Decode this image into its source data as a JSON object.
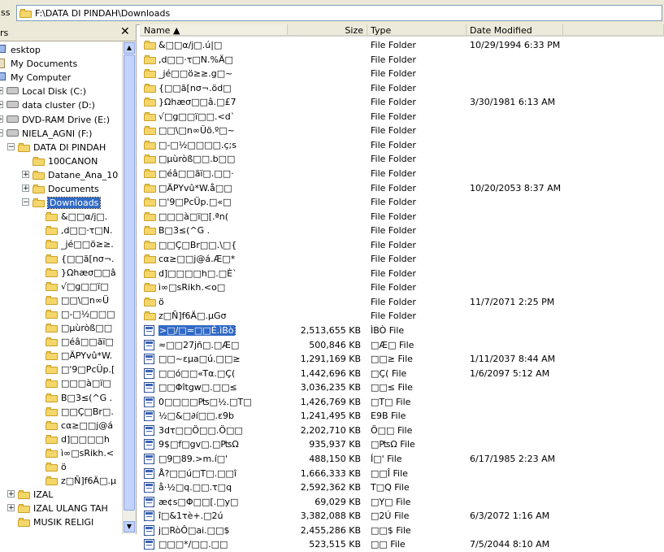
{
  "address": {
    "label": "ss",
    "path": "F:\\DATA DI PINDAH\\Downloads"
  },
  "tree": {
    "header": "rs",
    "close_glyph": "✕",
    "nodes": [
      {
        "label": "esktop",
        "icon": "desktop-icon",
        "level": 0,
        "expander": ""
      },
      {
        "label": "My Documents",
        "icon": "documents-icon",
        "level": 0,
        "expander": ""
      },
      {
        "label": "My Computer",
        "icon": "computer-icon",
        "level": 0,
        "expander": ""
      },
      {
        "label": "Local Disk (C:)",
        "icon": "drive-icon",
        "level": 1,
        "expander": "+"
      },
      {
        "label": "data cluster (D:)",
        "icon": "drive-icon",
        "level": 1,
        "expander": "+"
      },
      {
        "label": "DVD-RAM Drive (E:)",
        "icon": "drive-icon",
        "level": 1,
        "expander": "+"
      },
      {
        "label": "NIELA_AGNI (F:)",
        "icon": "drive-icon",
        "level": 1,
        "expander": "-"
      },
      {
        "label": "DATA DI PINDAH",
        "icon": "folder-icon",
        "level": 2,
        "expander": "-"
      },
      {
        "label": "100CANON",
        "icon": "folder-icon",
        "level": 3,
        "expander": ""
      },
      {
        "label": "Datane_Ana_10",
        "icon": "folder-icon",
        "level": 3,
        "expander": "+"
      },
      {
        "label": "Documents",
        "icon": "folder-icon",
        "level": 3,
        "expander": "+"
      },
      {
        "label": "Downloads",
        "icon": "folder-icon",
        "level": 3,
        "expander": "-",
        "selected": true
      },
      {
        "label": "&□□α/j□.",
        "icon": "folder-icon",
        "level": 4,
        "expander": ""
      },
      {
        "label": ",d□□·τ□N.",
        "icon": "folder-icon",
        "level": 4,
        "expander": ""
      },
      {
        "label": "_jé□□ö≥≥.",
        "icon": "folder-icon",
        "level": 4,
        "expander": ""
      },
      {
        "label": "{□□ã[nσ¬.",
        "icon": "folder-icon",
        "level": 4,
        "expander": ""
      },
      {
        "label": "}Ωhæσ□□â",
        "icon": "folder-icon",
        "level": 4,
        "expander": ""
      },
      {
        "label": "√□g□□ï□",
        "icon": "folder-icon",
        "level": 4,
        "expander": ""
      },
      {
        "label": "□□\\□n∞Ü",
        "icon": "folder-icon",
        "level": 4,
        "expander": ""
      },
      {
        "label": "□-□½□□□",
        "icon": "folder-icon",
        "level": 4,
        "expander": ""
      },
      {
        "label": "□µùròß□□",
        "icon": "folder-icon",
        "level": 4,
        "expander": ""
      },
      {
        "label": "□éâ□□ãï□",
        "icon": "folder-icon",
        "level": 4,
        "expander": ""
      },
      {
        "label": "□ÄPYvû*W.",
        "icon": "folder-icon",
        "level": 4,
        "expander": ""
      },
      {
        "label": "□'9□PcÜp.[",
        "icon": "folder-icon",
        "level": 4,
        "expander": ""
      },
      {
        "label": "□□□à□ï□",
        "icon": "folder-icon",
        "level": 4,
        "expander": ""
      },
      {
        "label": "B□3≤(^G .",
        "icon": "folder-icon",
        "level": 4,
        "expander": ""
      },
      {
        "label": "□□Ç□Br□.",
        "icon": "folder-icon",
        "level": 4,
        "expander": ""
      },
      {
        "label": "cα≥□□j@á",
        "icon": "folder-icon",
        "level": 4,
        "expander": ""
      },
      {
        "label": "d]□□□□h",
        "icon": "folder-icon",
        "level": 4,
        "expander": ""
      },
      {
        "label": "ì∞□sRikh.<",
        "icon": "folder-icon",
        "level": 4,
        "expander": ""
      },
      {
        "label": "ö",
        "icon": "folder-icon",
        "level": 4,
        "expander": ""
      },
      {
        "label": "z□Ñ]f6Ä□.µ",
        "icon": "folder-icon",
        "level": 4,
        "expander": ""
      },
      {
        "label": "IZAL",
        "icon": "folder-icon",
        "level": 2,
        "expander": "+"
      },
      {
        "label": "IZAL ULANG TAH",
        "icon": "folder-icon",
        "level": 2,
        "expander": "+"
      },
      {
        "label": "MUSIK RELIGI",
        "icon": "folder-icon",
        "level": 2,
        "expander": ""
      }
    ]
  },
  "columns": {
    "name": "Name ▲",
    "size": "Size",
    "type": "Type",
    "date": "Date Modified"
  },
  "files": [
    {
      "name": "&□□α/j□.ú|□",
      "size": "",
      "type": "File Folder",
      "date": "10/29/1994 6:33 PM",
      "kind": "folder"
    },
    {
      "name": ",d□□·τ□N.%Ä□",
      "size": "",
      "type": "File Folder",
      "date": "",
      "kind": "folder"
    },
    {
      "name": "_jé□□ö≥≥.g□~",
      "size": "",
      "type": "File Folder",
      "date": "",
      "kind": "folder"
    },
    {
      "name": "{□□ã[nσ¬.öd□",
      "size": "",
      "type": "File Folder",
      "date": "",
      "kind": "folder"
    },
    {
      "name": "}Ωhæσ□□â.□£7",
      "size": "",
      "type": "File Folder",
      "date": "3/30/1981 6:13 AM",
      "kind": "folder"
    },
    {
      "name": "√□g□□ï□□.<d`",
      "size": "",
      "type": "File Folder",
      "date": "",
      "kind": "folder"
    },
    {
      "name": "□□\\□n∞Üö.º□~",
      "size": "",
      "type": "File Folder",
      "date": "",
      "kind": "folder"
    },
    {
      "name": "□-□½□□□□.ç;s",
      "size": "",
      "type": "File Folder",
      "date": "",
      "kind": "folder"
    },
    {
      "name": "□µùròß□□.b□□",
      "size": "",
      "type": "File Folder",
      "date": "",
      "kind": "folder"
    },
    {
      "name": "□éâ□□ãï□.□□·",
      "size": "",
      "type": "File Folder",
      "date": "",
      "kind": "folder"
    },
    {
      "name": "□ÄPYvû*W.å□□",
      "size": "",
      "type": "File Folder",
      "date": "10/20/2053 8:37 AM",
      "kind": "folder"
    },
    {
      "name": "□'9□PcÜp.□«□",
      "size": "",
      "type": "File Folder",
      "date": "",
      "kind": "folder"
    },
    {
      "name": "□□□à□ï□[.ªn(",
      "size": "",
      "type": "File Folder",
      "date": "",
      "kind": "folder"
    },
    {
      "name": "B□3≤(^G .",
      "size": "",
      "type": "File Folder",
      "date": "",
      "kind": "folder"
    },
    {
      "name": "□□Ç□Br□□.\\□{",
      "size": "",
      "type": "File Folder",
      "date": "",
      "kind": "folder"
    },
    {
      "name": "cα≥□□j@á.Æ□*",
      "size": "",
      "type": "File Folder",
      "date": "",
      "kind": "folder"
    },
    {
      "name": "d]□□□□h□.□È`",
      "size": "",
      "type": "File Folder",
      "date": "",
      "kind": "folder"
    },
    {
      "name": "ì∞□sRikh.<o□",
      "size": "",
      "type": "File Folder",
      "date": "",
      "kind": "folder"
    },
    {
      "name": "ö",
      "size": "",
      "type": "File Folder",
      "date": "11/7/2071 2:25 PM",
      "kind": "folder"
    },
    {
      "name": "z□Ñ]f6Ä□.µGσ",
      "size": "",
      "type": "File Folder",
      "date": "",
      "kind": "folder"
    },
    {
      "name": ">□/□=□□É.ìBò",
      "size": "2,513,655 KB",
      "type": "ÌBÒ File",
      "date": "",
      "kind": "file",
      "selected": true
    },
    {
      "name": "≈□□27jñ□.□Æ□",
      "size": "500,846 KB",
      "type": "□Æ□ File",
      "date": "",
      "kind": "file"
    },
    {
      "name": "□□~εµa□ú.□□≥",
      "size": "1,291,169 KB",
      "type": "□□≥ File",
      "date": "1/11/2037 8:44 AM",
      "kind": "file"
    },
    {
      "name": "□□ó□□«Tα.□Ç(",
      "size": "1,442,696 KB",
      "type": "□Ç( File",
      "date": "1/6/2097 5:12 AM",
      "kind": "file"
    },
    {
      "name": "□□Φîtgw□.□□≤",
      "size": "3,036,235 KB",
      "type": "□□≤ File",
      "date": "",
      "kind": "file"
    },
    {
      "name": "0□□□□₧□½.□T□",
      "size": "1,426,769 KB",
      "type": "□T□ File",
      "date": "",
      "kind": "file"
    },
    {
      "name": "½□&□∂í□□.ε9b",
      "size": "1,241,495 KB",
      "type": "E9B File",
      "date": "",
      "kind": "file"
    },
    {
      "name": "3dτ□□Ö□□.Ö□□",
      "size": "2,202,710 KB",
      "type": "Ö□□ File",
      "date": "",
      "kind": "file"
    },
    {
      "name": "9$□f□gv□.□₧Ω",
      "size": "935,937 KB",
      "type": "□₧Ω File",
      "date": "",
      "kind": "file"
    },
    {
      "name": "□9□89.>m.í□'",
      "size": "488,150 KB",
      "type": "Í□' File",
      "date": "6/17/1985 2:23 AM",
      "kind": "file"
    },
    {
      "name": "Å?□□ú□T□.□□î",
      "size": "1,666,333 KB",
      "type": "□□Î File",
      "date": "",
      "kind": "file"
    },
    {
      "name": "å·½□q.□□.τ□q",
      "size": "2,592,362 KB",
      "type": "T□Q File",
      "date": "",
      "kind": "file"
    },
    {
      "name": "æ¢s□Φ□□[.□y□",
      "size": "69,029 KB",
      "type": "□Y□ File",
      "date": "",
      "kind": "file"
    },
    {
      "name": "î□&1τè+.□2ú",
      "size": "3,382,088 KB",
      "type": "□2Ú File",
      "date": "6/3/2072 1:16 AM",
      "kind": "file"
    },
    {
      "name": "j□RòÔ□ai.□□$",
      "size": "2,455,286 KB",
      "type": "□□$ File",
      "date": "",
      "kind": "file"
    },
    {
      "name": "□□□*/□□.□□",
      "size": "523,515 KB",
      "type": "□□ File",
      "date": "7/5/2044 8:10 AM",
      "kind": "file"
    }
  ]
}
